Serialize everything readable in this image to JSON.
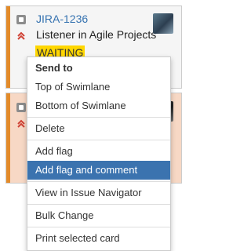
{
  "card1": {
    "key": "JIRA-1236",
    "summary": "Listener in Agile Projects",
    "status": "WAITING",
    "type_icon": "issue-type-icon",
    "priority_icon": "priority-highest-icon"
  },
  "card2": {
    "type_icon": "issue-type-icon",
    "priority_icon": "priority-highest-icon"
  },
  "menu": {
    "title": "Send to",
    "top_of_swimlane": "Top of Swimlane",
    "bottom_of_swimlane": "Bottom of Swimlane",
    "delete": "Delete",
    "add_flag": "Add flag",
    "add_flag_and_comment": "Add flag and comment",
    "view_in_issue_navigator": "View in Issue Navigator",
    "bulk_change": "Bulk Change",
    "print_selected_card": "Print selected card"
  },
  "colors": {
    "accent": "#3b73af",
    "link": "#3572b0",
    "status_bg": "#ffd700",
    "grabber": "#e38b2a",
    "selected_card_bg": "#f7d8c5"
  }
}
